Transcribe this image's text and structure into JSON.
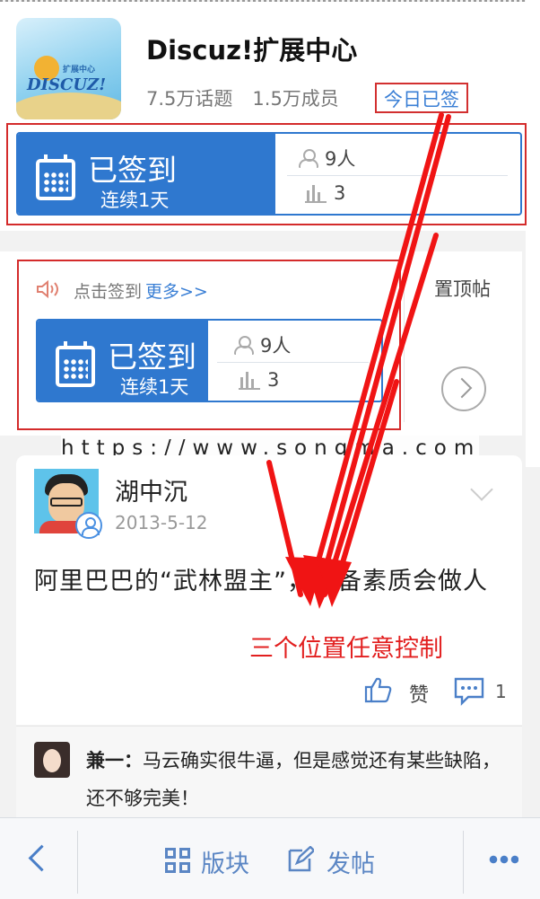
{
  "group": {
    "title": "Discuz!扩展中心",
    "topics": "7.5万话题",
    "members": "1.5万成员",
    "signed_today": "今日已签",
    "logo_line1": "扩展中心",
    "logo_line2": "DISCUZ!"
  },
  "checkin_card_top": {
    "status": "已签到",
    "streak": "连续1天",
    "people": "9人",
    "rank": "3"
  },
  "checkin_section": {
    "notice": "点击签到",
    "more_link": "更多>>",
    "pinned_label": "置顶帖",
    "card": {
      "status": "已签到",
      "streak": "连续1天",
      "people": "9人",
      "rank": "3"
    }
  },
  "watermark": "https://www.songma.com",
  "post": {
    "author": "湖中沉",
    "date": "2013-5-12",
    "content": "阿里巴巴的“武林盟主”，必备素质会做人",
    "like_label": "赞",
    "comment_count": "1"
  },
  "annotation": "三个位置任意控制",
  "reply": {
    "author": "兼一：",
    "text": "马云确实很牛逼，但是感觉还有某些缺陷，还不够完美！"
  },
  "bottom_bar": {
    "blocks_label": "版块",
    "post_label": "发帖"
  },
  "colors": {
    "accent_blue": "#2f78cf",
    "annotation_red": "#e21f1f"
  }
}
